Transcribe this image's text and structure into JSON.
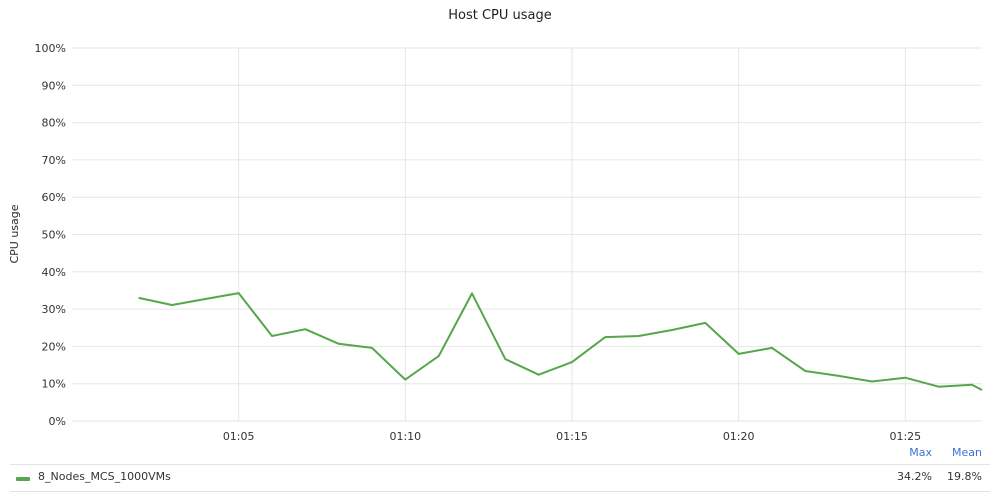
{
  "chart_data": {
    "type": "line",
    "title": "Host CPU usage",
    "ylabel": "CPU usage",
    "xlabel": "",
    "ylim": [
      0,
      100
    ],
    "y_ticks": [
      "0%",
      "10%",
      "20%",
      "30%",
      "40%",
      "50%",
      "60%",
      "70%",
      "80%",
      "90%",
      "100%"
    ],
    "x_ticks": [
      "01:05",
      "01:10",
      "01:15",
      "01:20",
      "01:25"
    ],
    "x_tick_values": [
      5,
      10,
      15,
      20,
      25
    ],
    "grid": true,
    "color": "#56a64b",
    "series": [
      {
        "name": "8_Nodes_MCS_1000VMs",
        "x": [
          2,
          3,
          4,
          5,
          6,
          7,
          8,
          9,
          10,
          11,
          12,
          13,
          14,
          15,
          16,
          17,
          18,
          19,
          20,
          21,
          22,
          23,
          24,
          25,
          26,
          27,
          27.3
        ],
        "values": [
          33.0,
          31.1,
          32.7,
          34.3,
          22.8,
          24.6,
          20.7,
          19.6,
          11.1,
          17.4,
          34.2,
          16.6,
          12.4,
          15.8,
          22.5,
          22.8,
          24.4,
          26.3,
          18.0,
          19.6,
          13.4,
          12.1,
          10.6,
          11.6,
          9.2,
          9.7,
          8.3
        ]
      }
    ]
  },
  "legend": {
    "headers": {
      "max": "Max",
      "mean": "Mean"
    },
    "rows": [
      {
        "name": "8_Nodes_MCS_1000VMs",
        "max": "34.2%",
        "mean": "19.8%"
      }
    ]
  }
}
